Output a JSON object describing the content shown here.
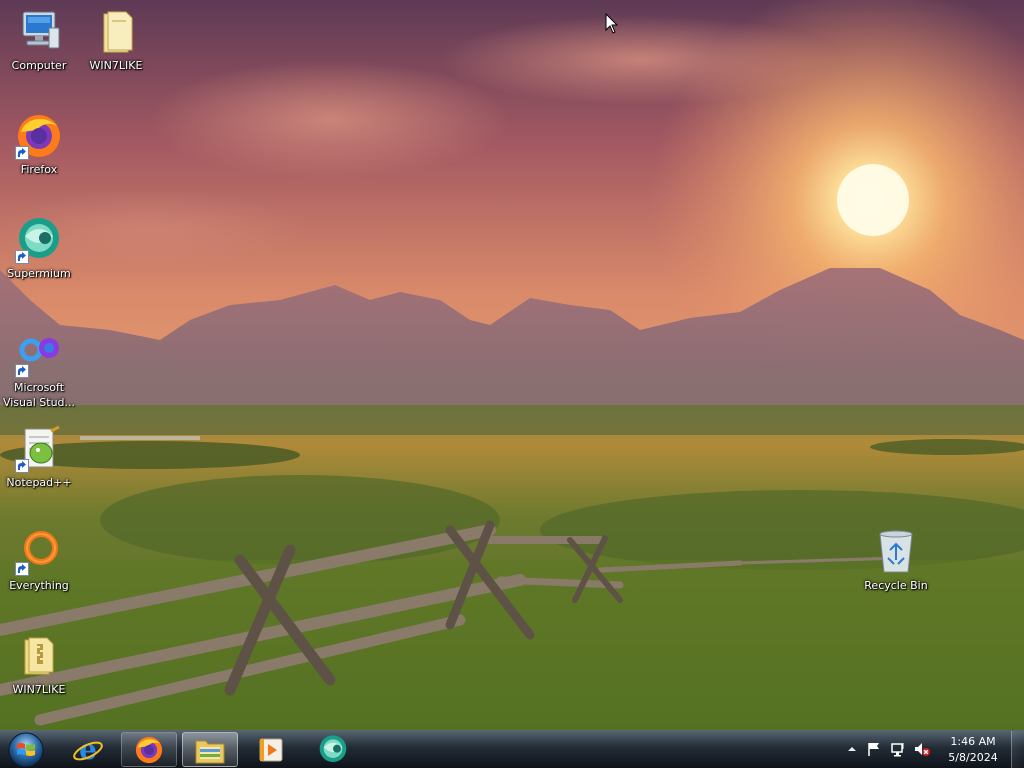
{
  "desktop": {
    "icons": [
      {
        "label": "Computer",
        "icon": "computer-icon"
      },
      {
        "label": "WIN7LIKE",
        "icon": "folder-icon"
      },
      {
        "label": "Firefox",
        "icon": "firefox-icon"
      },
      {
        "label": "Supermium",
        "icon": "supermium-icon"
      },
      {
        "label": "Microsoft\nVisual Stud...",
        "icon": "visual-studio-icon"
      },
      {
        "label": "Notepad++",
        "icon": "notepad-plus-plus-icon"
      },
      {
        "label": "Everything",
        "icon": "everything-icon"
      },
      {
        "label": "WIN7LIKE",
        "icon": "zip-folder-icon"
      },
      {
        "label": "Recycle Bin",
        "icon": "recycle-bin-icon"
      }
    ]
  },
  "taskbar": {
    "pinned": [
      {
        "name": "Internet Explorer",
        "icon": "internet-explorer-icon"
      },
      {
        "name": "Firefox",
        "icon": "firefox-icon"
      },
      {
        "name": "File Explorer",
        "icon": "file-explorer-icon"
      },
      {
        "name": "Media Player",
        "icon": "media-player-icon"
      },
      {
        "name": "Supermium",
        "icon": "supermium-icon"
      }
    ],
    "tray": {
      "icons": [
        "show-hidden-icons-chevron",
        "action-center-flag-icon",
        "network-icon",
        "volume-muted-icon"
      ]
    },
    "clock": {
      "time": "1:46 AM",
      "date": "5/8/2024"
    }
  },
  "colors": {
    "sky_top": "#6e3f57",
    "sky_glow": "#f0a66b",
    "mountains": "#9a6e7a",
    "field": "#7a8a30",
    "taskbar": "#1a2530"
  }
}
